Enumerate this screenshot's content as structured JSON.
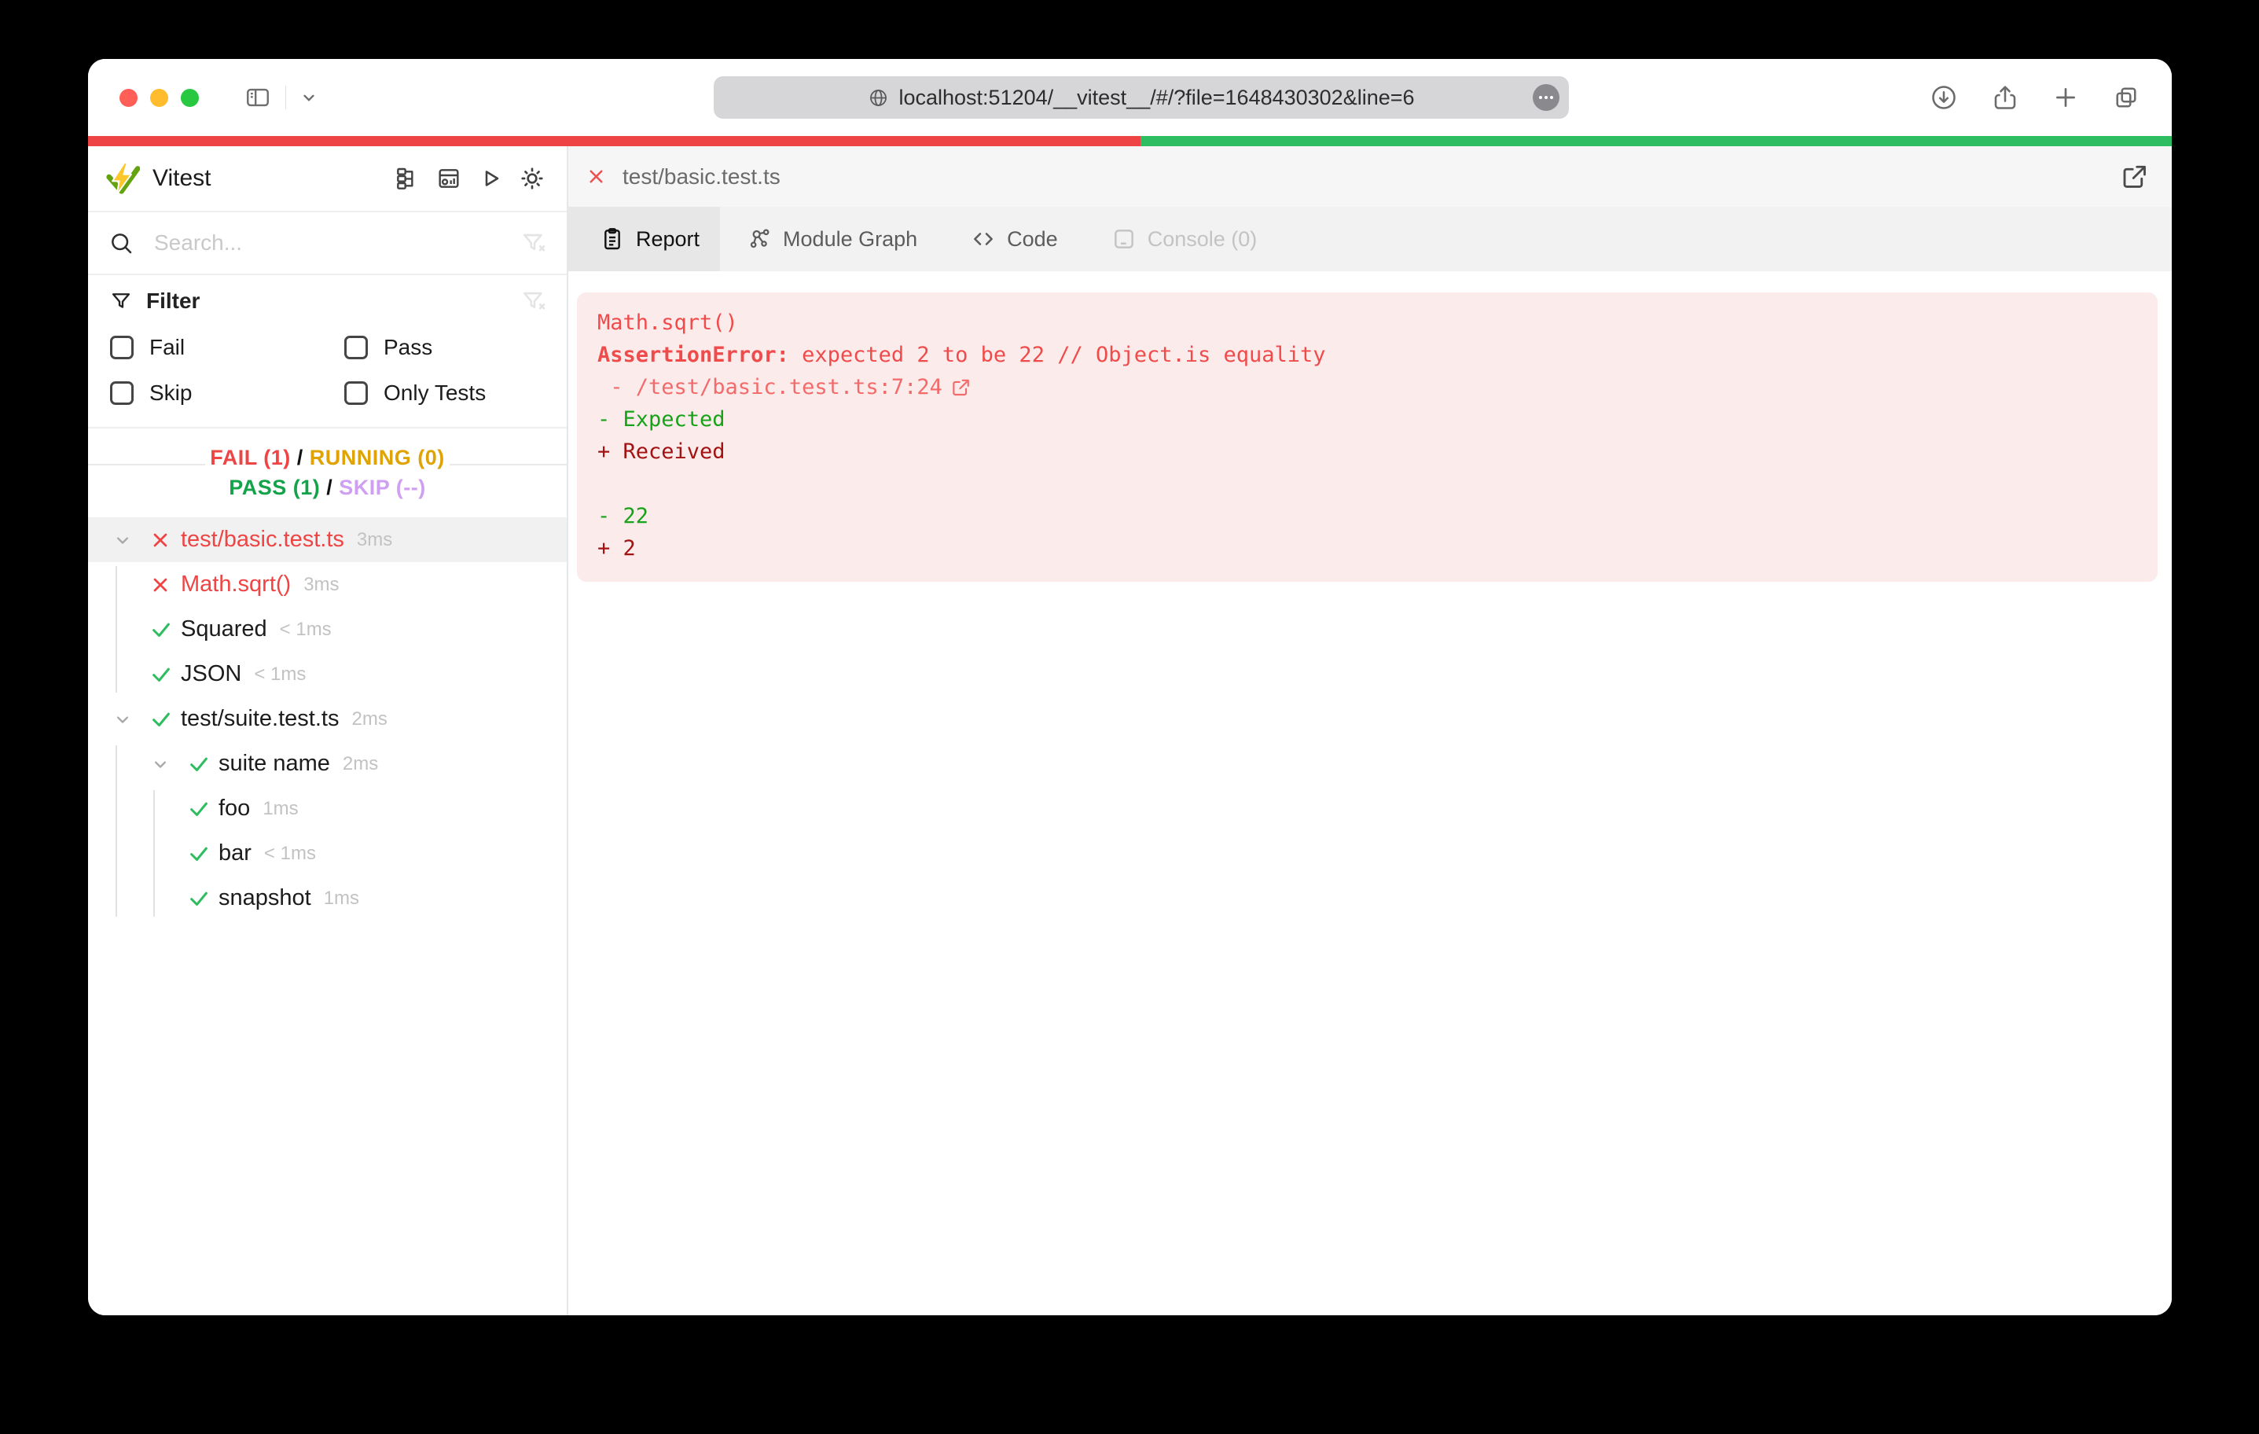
{
  "browser": {
    "url": "localhost:51204/__vitest__/#/?file=1648430302&line=6"
  },
  "titlebar_icons": [
    "sidebar-toggle",
    "chevron-down",
    "download",
    "share",
    "new-tab",
    "show-tabs"
  ],
  "sidebar": {
    "app_title": "Vitest",
    "toolbar_icons": [
      "tree-view",
      "dashboard",
      "run-all",
      "theme-toggle"
    ],
    "search": {
      "placeholder": "Search..."
    },
    "filter": {
      "title": "Filter",
      "options": [
        {
          "label": "Fail"
        },
        {
          "label": "Pass"
        },
        {
          "label": "Skip"
        },
        {
          "label": "Only Tests"
        }
      ]
    },
    "stats": {
      "fail": "FAIL (1)",
      "running": "RUNNING (0)",
      "pass": "PASS (1)",
      "skip": "SKIP (--)",
      "separator": "/"
    },
    "tree": [
      {
        "label": "test/basic.test.ts",
        "time": "3ms",
        "status": "fail",
        "level": 0,
        "expandable": true,
        "selected": true
      },
      {
        "label": "Math.sqrt()",
        "time": "3ms",
        "status": "fail",
        "level": 1
      },
      {
        "label": "Squared",
        "time": "< 1ms",
        "status": "pass",
        "level": 1
      },
      {
        "label": "JSON",
        "time": "< 1ms",
        "status": "pass",
        "level": 1
      },
      {
        "label": "test/suite.test.ts",
        "time": "2ms",
        "status": "pass",
        "level": 0,
        "expandable": true
      },
      {
        "label": "suite name",
        "time": "2ms",
        "status": "pass",
        "level": 1,
        "expandable": true
      },
      {
        "label": "foo",
        "time": "1ms",
        "status": "pass",
        "level": 2
      },
      {
        "label": "bar",
        "time": "< 1ms",
        "status": "pass",
        "level": 2
      },
      {
        "label": "snapshot",
        "time": "1ms",
        "status": "pass",
        "level": 2
      }
    ]
  },
  "main": {
    "file_tab": {
      "label": "test/basic.test.ts",
      "status": "fail"
    },
    "tabs": [
      {
        "label": "Report",
        "icon": "report",
        "active": true
      },
      {
        "label": "Module Graph",
        "icon": "graph"
      },
      {
        "label": "Code",
        "icon": "code"
      },
      {
        "label": "Console (0)",
        "icon": "console",
        "disabled": true
      }
    ],
    "report": {
      "test_name": "Math.sqrt()",
      "error_name": "AssertionError: ",
      "error_message": "expected 2 to be 22 // Object.is equality",
      "stack_line": " - /test/basic.test.ts:7:24",
      "diff": [
        {
          "text": "- Expected",
          "kind": "green"
        },
        {
          "text": "+ Received",
          "kind": "red"
        },
        {
          "text": "",
          "kind": "plain"
        },
        {
          "text": "- 22",
          "kind": "green"
        },
        {
          "text": "+ 2",
          "kind": "red"
        }
      ]
    }
  },
  "colors": {
    "fail_red": "#ef4444",
    "pass_green_dark": "#14a34a",
    "check_green": "#2dbd5f",
    "running_amber": "#dfa305",
    "skip_purple": "#cf9ff2",
    "progress_red": "#ef4444",
    "progress_green": "#2ebd61",
    "error_red": "#f04b4b",
    "error_red_soft": "#f26a6a",
    "diff_green": "#16a317",
    "diff_dark_red": "#a31212",
    "error_bg_pink": "#fcebeb"
  }
}
